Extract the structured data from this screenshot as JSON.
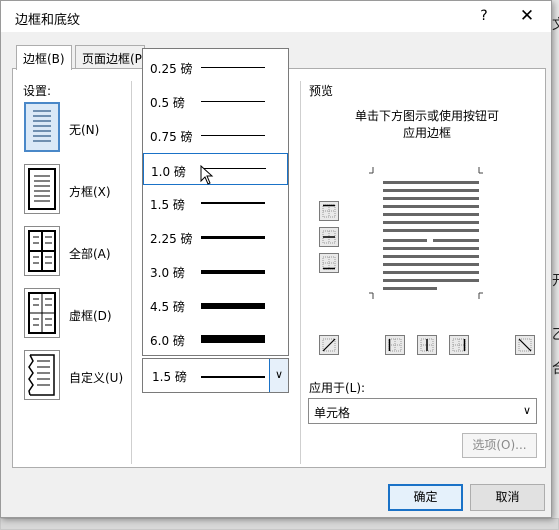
{
  "dialog": {
    "title": "边框和底纹",
    "help_label": "?",
    "close_label": "✕"
  },
  "tabs": [
    {
      "label": "边框(B)",
      "active": true
    },
    {
      "label": "页面边框(P",
      "active": false
    }
  ],
  "settings": {
    "heading": "设置:",
    "items": [
      {
        "label": "无(N)",
        "icon": "border-none-icon",
        "selected": true
      },
      {
        "label": "方框(X)",
        "icon": "border-box-icon",
        "selected": false
      },
      {
        "label": "全部(A)",
        "icon": "border-all-icon",
        "selected": false
      },
      {
        "label": "虚框(D)",
        "icon": "border-grid-icon",
        "selected": false
      },
      {
        "label": "自定义(U)",
        "icon": "border-custom-icon",
        "selected": false
      }
    ]
  },
  "width_dropdown": {
    "options": [
      {
        "label": "0.25 磅",
        "weight": 0.25
      },
      {
        "label": "0.5 磅",
        "weight": 0.5
      },
      {
        "label": "0.75 磅",
        "weight": 0.75
      },
      {
        "label": "1.0 磅",
        "weight": 1.0,
        "hovered": true
      },
      {
        "label": "1.5 磅",
        "weight": 1.5
      },
      {
        "label": "2.25 磅",
        "weight": 2.25
      },
      {
        "label": "3.0 磅",
        "weight": 3.0
      },
      {
        "label": "4.5 磅",
        "weight": 4.5
      },
      {
        "label": "6.0 磅",
        "weight": 6.0
      }
    ],
    "selected_label": "1.5 磅",
    "arrow": "∨"
  },
  "preview": {
    "heading": "预览",
    "help_line1": "单击下方图示或使用按钮可",
    "help_line2": "应用边框"
  },
  "apply_to": {
    "label": "应用于(L):",
    "value": "单元格",
    "arrow": "∨"
  },
  "buttons": {
    "options": "选项(O)...",
    "ok": "确定",
    "cancel": "取消"
  },
  "background": {
    "chars": [
      "文",
      "开",
      "乙",
      "合"
    ]
  },
  "colors": {
    "accent": "#1a72c7",
    "selected_bg": "#dbe9f7"
  }
}
